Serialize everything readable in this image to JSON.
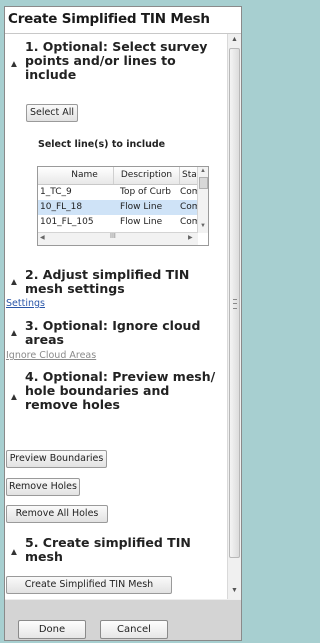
{
  "panel": {
    "title": "Create Simplified TIN Mesh"
  },
  "sections": {
    "s1": {
      "title_lines": [
        "1. Optional: Select survey",
        "points and/or lines to",
        "include"
      ],
      "select_all_label": "Select All",
      "lines_label": "Select line(s) to include",
      "table": {
        "columns": [
          "Name",
          "Description",
          "Sta"
        ],
        "rows": [
          {
            "name": "1_TC_9",
            "description": "Top of Curb",
            "status": "Com",
            "selected": false
          },
          {
            "name": "10_FL_18",
            "description": "Flow Line",
            "status": "Com",
            "selected": true
          },
          {
            "name": "101_FL_105",
            "description": "Flow Line",
            "status": "Com",
            "selected": false
          }
        ],
        "scroll_marker": "III"
      }
    },
    "s2": {
      "title_lines": [
        "2. Adjust simplified TIN",
        "mesh settings"
      ],
      "link": "Settings"
    },
    "s3": {
      "title_lines": [
        "3. Optional: Ignore cloud",
        "areas"
      ],
      "link": "Ignore Cloud Areas"
    },
    "s4": {
      "title_lines": [
        "4. Optional: Preview mesh/",
        "hole boundaries and",
        "remove holes"
      ],
      "buttons": [
        "Preview Boundaries",
        "Remove Holes",
        "Remove All Holes"
      ]
    },
    "s5": {
      "title_lines": [
        "5. Create simplified TIN",
        "mesh"
      ],
      "button": "Create Simplified TIN Mesh"
    }
  },
  "footer": {
    "done": "Done",
    "cancel": "Cancel"
  },
  "colors": {
    "background": "#a7cfd0",
    "link": "#2a56a8",
    "selected_row": "#cfe3f7"
  }
}
